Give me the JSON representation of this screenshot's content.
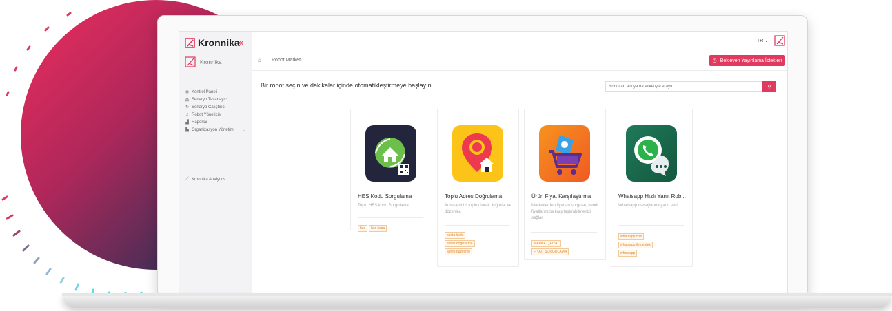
{
  "app": {
    "logo_text": "Kronnika",
    "brand_name": "Kronnika",
    "collapse_glyph": "«",
    "language": "TR",
    "accent_color": "#e23a5e"
  },
  "sidebar": {
    "items": [
      {
        "label": "Kontrol Paneli",
        "icon": "eye-icon"
      },
      {
        "label": "Senaryo Tasarlayıcı",
        "icon": "sitemap-icon"
      },
      {
        "label": "Senaryo Çalıştırıcı",
        "icon": "rerun-icon"
      },
      {
        "label": "Robot Yöneticisi",
        "icon": "key-icon"
      },
      {
        "label": "Raporlar",
        "icon": "bar-chart-icon"
      },
      {
        "label": "Organizasyon Yönetimi",
        "icon": "building-icon"
      }
    ],
    "analytics_label": "Kronnika Analytics"
  },
  "breadcrumb": {
    "label": "Robot Marketi"
  },
  "pending_button": {
    "label": "Bekleyen Yayınlama İstekleri"
  },
  "main": {
    "heading": "Bir robot seçin ve dakikalar içinde otomatikleştirmeye başlayın !",
    "search_placeholder": "Robotları adı ya da etiketiyle arayın..."
  },
  "cards": [
    {
      "title": "HES Kodu Sorgulama",
      "desc": "Toplu HES kodu Sorgulama",
      "tags": [
        "hes",
        "hes kodu"
      ],
      "icon": "hes-house-icon"
    },
    {
      "title": "Toplu Adres Doğrulama",
      "desc": "Adreslerinizi toplu olarak doğrular ve düzenler.",
      "tags": [
        "posta kodu",
        "adres doğrulama",
        "adres düzeltme"
      ],
      "icon": "address-pin-icon"
    },
    {
      "title": "Ürün Fiyat Karşılaştırma",
      "desc": "Marketlerden fiyatları sorgular, kendi fiyatlarınızla karşılaştırabilmenizi sağlar.",
      "tags": [
        "MARKET_FIYAT",
        "FIYAT_SORGULAMA"
      ],
      "icon": "shopping-cart-icon"
    },
    {
      "title": "Whatsapp Hızlı Yanıt Rob...",
      "desc": "Whatsapp mesajlarına yanıt verir.",
      "tags": [
        "whatsapp crm",
        "whatsapp ile destek",
        "whatsapp"
      ],
      "icon": "whatsapp-icon"
    }
  ]
}
